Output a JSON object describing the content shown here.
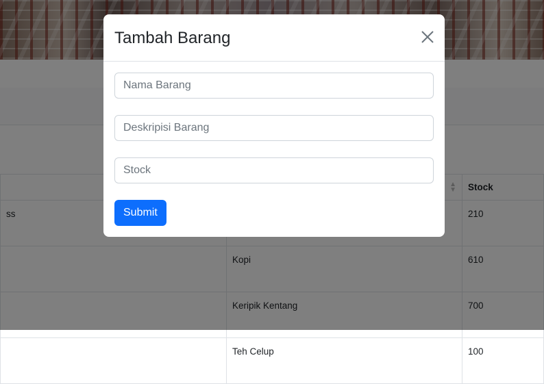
{
  "modal": {
    "title": "Tambah Barang",
    "close_icon": "close-icon",
    "fields": {
      "nama_placeholder": "Nama Barang",
      "deskripsi_placeholder": "Deskripisi Barang",
      "stock_placeholder": "Stock"
    },
    "submit_label": "Submit",
    "accent_color": "#0d6efd"
  },
  "table": {
    "headers": [
      "",
      "",
      "Stock"
    ],
    "rows": [
      [
        "ss",
        "",
        "210"
      ],
      [
        "",
        "Kopi",
        "610"
      ],
      [
        "",
        "Keripik Kentang",
        "700"
      ],
      [
        "",
        "Teh Celup",
        "100"
      ]
    ]
  }
}
